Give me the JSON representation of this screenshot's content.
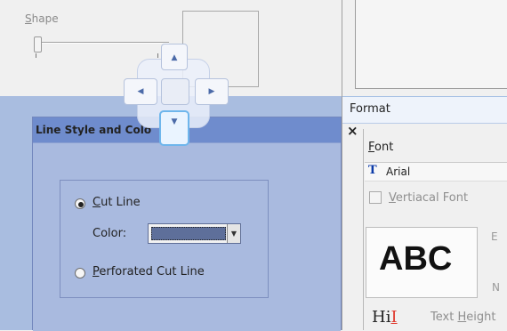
{
  "shape_panel": {
    "label_first": "S",
    "label_rest": "hape"
  },
  "dialog": {
    "title": "Line Style and Colo",
    "option_cut": {
      "first": "C",
      "rest": "ut Line",
      "selected": true
    },
    "color_label": "Color:",
    "color_value": "#5e6f9a",
    "option_perforated": {
      "first": "P",
      "rest": "erforated Cut Line",
      "selected": false
    }
  },
  "docking_guide": {
    "arrows": [
      "up-arrow",
      "left-arrow",
      "right-arrow",
      "down-arrow"
    ]
  },
  "format_panel": {
    "title": "Format",
    "close": "×",
    "font_label_first": "F",
    "font_label_rest": "ont",
    "font_icon": "T",
    "font_name": "Arial",
    "vertical_label_first": "V",
    "vertical_label_rest": "ertiacal Font",
    "preview_text": "ABC",
    "side_b": "E",
    "side_n": "N",
    "hi_text": "Hi",
    "hi_red": "I",
    "text_height_prefix": "Text ",
    "text_height_u": "H",
    "text_height_rest": "eight"
  }
}
